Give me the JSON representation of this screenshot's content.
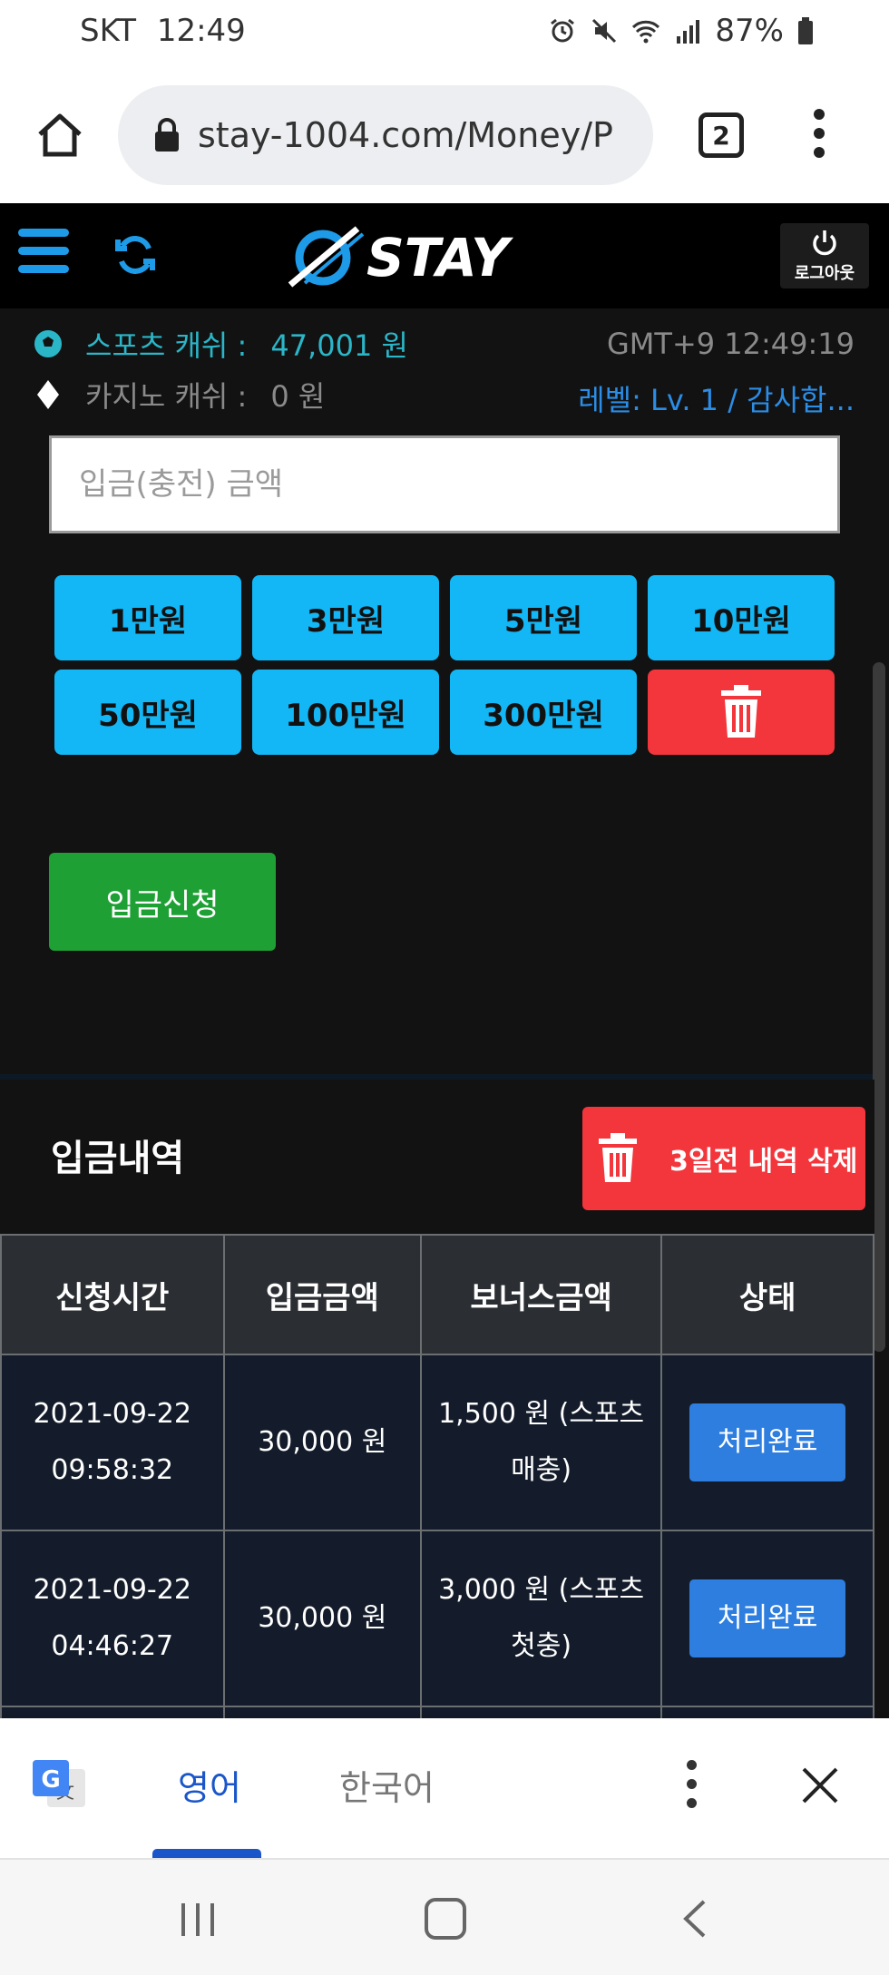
{
  "status_bar": {
    "carrier": "SKT",
    "time": "12:49",
    "battery": "87%"
  },
  "browser": {
    "url": "stay-1004.com/Money/P",
    "tab_count": "2"
  },
  "site": {
    "logo_text": "STAY",
    "logout_label": "로그아웃"
  },
  "info": {
    "sports_cash_label": "스포츠 캐쉬 :",
    "sports_cash_value": "47,001 원",
    "casino_cash_label": "카지노 캐쉬 :",
    "casino_cash_value": "0 원",
    "clock": "GMT+9 12:49:19",
    "level": "레벨: Lv. 1 / 감사합..."
  },
  "deposit_form": {
    "amount_placeholder": "입금(충전) 금액",
    "chips": [
      "1만원",
      "3만원",
      "5만원",
      "10만원",
      "50만원",
      "100만원",
      "300만원"
    ],
    "submit_label": "입금신청"
  },
  "history": {
    "title": "입금내역",
    "delete_label": "3일전 내역 삭제",
    "columns": [
      "신청시간",
      "입금금액",
      "보너스금액",
      "상태"
    ],
    "rows": [
      {
        "date": "2021-09-22",
        "time": "09:58:32",
        "amount": "30,000 원",
        "bonus_line1": "1,500 원 (스포츠",
        "bonus_line2": "매충)",
        "status": "처리완료"
      },
      {
        "date": "2021-09-22",
        "time": "04:46:27",
        "amount": "30,000 원",
        "bonus_line1": "3,000 원 (스포츠",
        "bonus_line2": "첫충)",
        "status": "처리완료"
      }
    ]
  },
  "translate_bar": {
    "lang_active": "영어",
    "lang_other": "한국어"
  },
  "colors": {
    "accent_blue": "#13b7f5",
    "delete_red": "#f3353c",
    "submit_green": "#1fa035",
    "status_blue": "#2e7ee0"
  }
}
